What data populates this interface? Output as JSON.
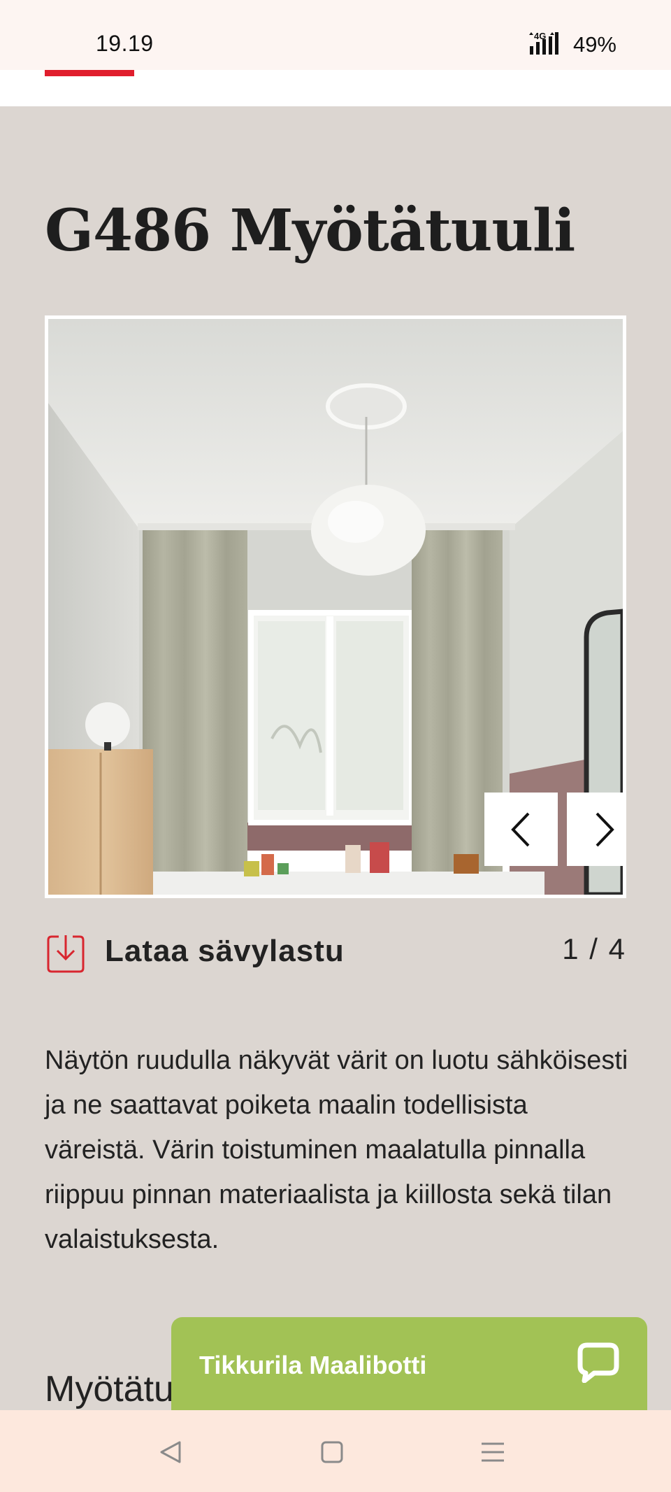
{
  "status_bar": {
    "time": "19.19",
    "network": "4G",
    "battery": "49%"
  },
  "page": {
    "title": "G486 Myötätuuli",
    "accent_color": "#e01e2d",
    "background_color": "#dcd6d1"
  },
  "carousel": {
    "image_description_icon": "room-photo",
    "prev_icon": "chevron-left-icon",
    "next_icon": "chevron-right-icon",
    "counter": "1 / 4"
  },
  "download": {
    "label": "Lataa sävylastu",
    "icon": "download-icon"
  },
  "disclaimer": "Näytön ruudulla näkyvät värit on luotu sähköisesti ja ne saattavat poiketa maalin todellisista väreistä. Värin toistuminen maalatulla pinnalla riippuu pinnan materiaalista ja kiillosta sekä tilan valaistuksesta.",
  "section": {
    "heading": "Myötätu"
  },
  "chatbot": {
    "label": "Tikkurila Maalibotti",
    "icon": "chat-bubble-icon",
    "color": "#a2c255"
  },
  "system_nav": {
    "back_icon": "back-triangle-icon",
    "home_icon": "home-square-icon",
    "menu_icon": "menu-lines-icon"
  }
}
